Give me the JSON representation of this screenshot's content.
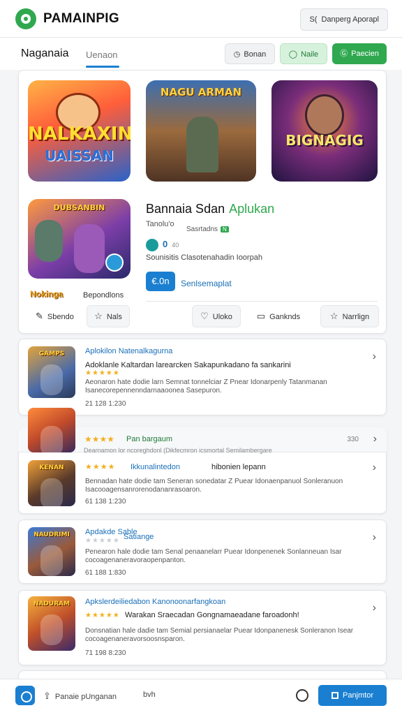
{
  "header": {
    "title": "PAMAINPIG",
    "action_label": "Danperg Aporapl",
    "action_prefix": "S("
  },
  "subnav": {
    "active_tab": "Naganaia",
    "second_tab": "Uenaon",
    "pill_1": "Bonan",
    "pill_2": "Naile",
    "pill_3": "Paecien"
  },
  "feature": {
    "thumb_1_line1": "NALKAXIN",
    "thumb_1_line2": "UAISSAN",
    "thumb_2_text": "NAGU ARMAN",
    "thumb_3_text": "BIGNAGIG",
    "thumb_4_text": "DUBSANBIN",
    "mini_logo": "Nokinga",
    "mini_label": "Bepondlons",
    "title": "Bannaia Sdan",
    "title_accent": "Aplukan",
    "meta_1": "Tanolu'o",
    "meta_2": "Sasrtadns",
    "meta_2_tag": "N",
    "score": "0",
    "score_small": "40",
    "description": "Sounisitis Clasotenahadin Ioorpah",
    "price": "€.0n",
    "price_note": "Senlsemaplat",
    "actions": [
      {
        "icon": "edit-icon",
        "label": "Sbendo"
      },
      {
        "icon": "star-icon",
        "label": "Nals"
      },
      {
        "icon": "heart-icon",
        "label": "Uloko"
      },
      {
        "icon": "bookmark-icon",
        "label": "Ganknds"
      },
      {
        "icon": "star-outline-icon",
        "label": "Narrlign"
      }
    ]
  },
  "list": [
    {
      "thumb_text": "GAMPS",
      "title": "Aplokilon Natenalkagurna",
      "subtitle": "Adoklanle Kaltardan larearcken Sakapunkadano fa sankarini",
      "stars": "★★★★★",
      "desc": "Aeonaron hate dodie larn Semnat tonnelciar Z Pnear Idonarpenly Tatanmanan Isanecorepennenndarnaaoonea Sasepuron.",
      "date": "21 128 1:230"
    },
    {
      "thumb_text": "KENAN",
      "stars": "★★★★",
      "strip_title": "Pan bargaum",
      "strip_count": "330",
      "strip_note": "Dearnamon lor ncoreghdonl (Dikfecmron icsmortal Semilambergare",
      "title_stars": "★★★★",
      "title": "Ikkunalintedon",
      "subtitle": "hibonien lepann",
      "desc": "Bennadan hate dodie tam Seneran sonedatar Z Puear Idonaenpanuol Sonleranuon Isacooagensanrorenodananrasoaron.",
      "date": "61 138 1:230"
    },
    {
      "thumb_text": "NAUDRIMI",
      "title": "Apdakde Sable",
      "subtitle": "Satiange",
      "stars": "★★★★★",
      "desc": "Penearon hale dodie tam Senal penaanelarr Puear Idonpenenek Sonlanneuan Isar cocoagenaneravoraopenpanton.",
      "date": "61 188 1:830"
    },
    {
      "thumb_text": "NADURAM",
      "title": "Apkslerdeiliedabon Kanonoonarfangkoan",
      "subtitle": "Warakan Sraecadan Gongnamaeadane faroadonh!",
      "stars": "★★★★★",
      "desc": "Donsnatian hale dadie tam Semial persianaelar Puear Idonpanenesk Sonleranon Isear cocoagenaneravorsoosnsparon.",
      "date": "71 198 8:230"
    }
  ],
  "bottombar": {
    "share_label": "Panaie pUnganan",
    "extra_label": "bvh",
    "cta_label": "Panjmtor"
  },
  "colors": {
    "brand_green": "#2fa84f",
    "accent_blue": "#1a7fd1",
    "star_gold": "#f2b01e"
  }
}
